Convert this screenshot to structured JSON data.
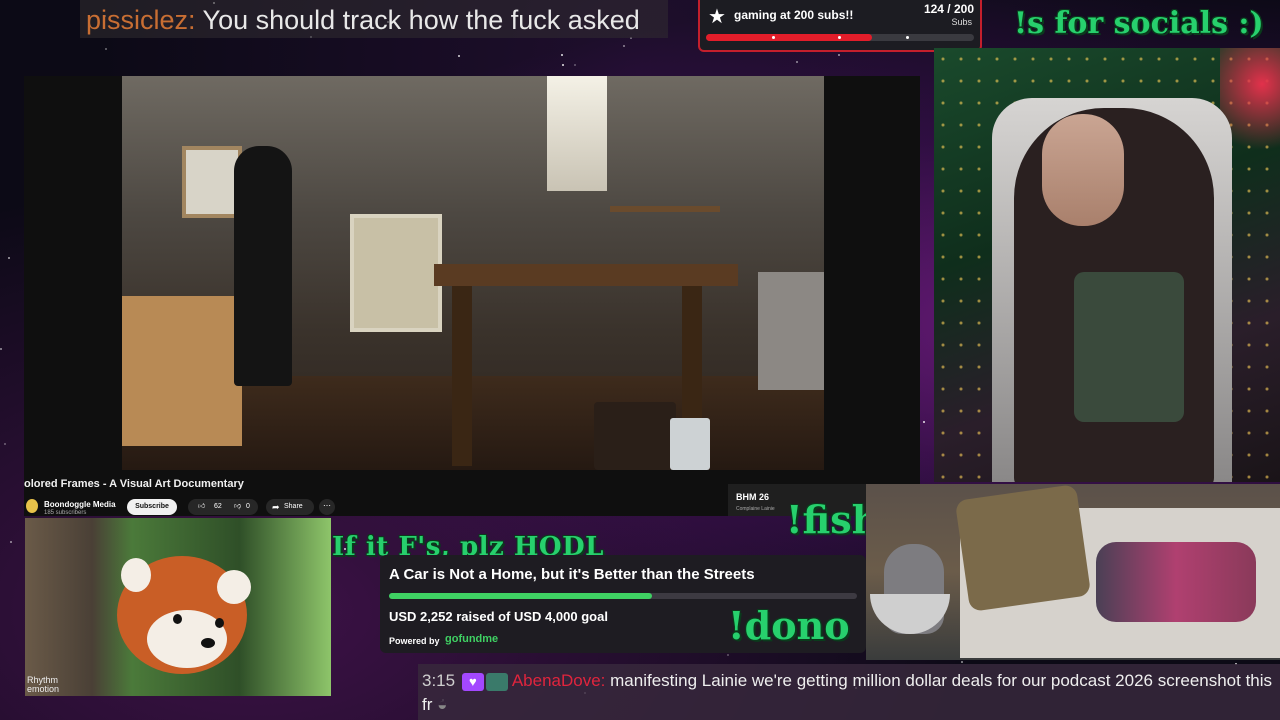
{
  "top_chat": {
    "username": "pissiclez:",
    "message": "You should track how the fuck asked"
  },
  "sub_goal": {
    "title": "gaming at 200 subs!!",
    "count": "124 / 200",
    "unit": "Subs",
    "progress_fraction": 0.62
  },
  "overlay_text": {
    "socials": "!s for socials :)",
    "fish": "!fish",
    "dono": "!dono",
    "hodl": "If it F's, plz HODL"
  },
  "video": {
    "title": "olored Frames - A Visual Art Documentary",
    "channel": "Boondoggle Media",
    "subscribers": "185 subscribers",
    "subscribe_label": "Subscribe",
    "likes": "62",
    "dislikes": "0",
    "share_label": "Share",
    "side_title": "BHM 26",
    "side_sub": "Complaine Lainie"
  },
  "donation": {
    "title": "A Car is Not a Home, but it's Better than the Streets",
    "raised_text": "USD 2,252 raised of USD 4,000 goal",
    "progress_fraction": 0.563,
    "powered_label": "Powered by",
    "brand": "gofundme"
  },
  "panda_logo": {
    "line1": "Rhythm",
    "line2": "emotion"
  },
  "bottom_chat": {
    "time": "3:15",
    "username": "AbenaDove:",
    "message": "manifesting Lainie we're getting million dollar deals for our podcast 2026 screenshot this fr"
  },
  "colors": {
    "accent_red": "#e21d2a",
    "socials_green": "#27d06d",
    "gofundme_green": "#3fd163"
  }
}
